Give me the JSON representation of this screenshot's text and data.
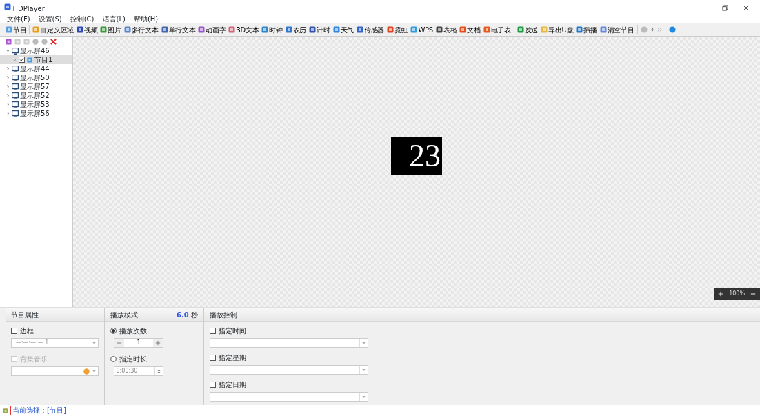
{
  "window": {
    "title": "HDPlayer"
  },
  "menu": [
    "文件(F)",
    "设置(S)",
    "控制(C)",
    "语言(L)",
    "帮助(H)"
  ],
  "toolbar": {
    "groups": [
      [
        {
          "label": "节目"
        }
      ],
      [
        {
          "label": "自定义区域"
        },
        {
          "label": "视频"
        },
        {
          "label": "图片"
        },
        {
          "label": "多行文本"
        },
        {
          "label": "单行文本"
        },
        {
          "label": "动画字"
        },
        {
          "label": "3D文本"
        },
        {
          "label": "时钟"
        },
        {
          "label": "农历"
        },
        {
          "label": "计时"
        },
        {
          "label": "天气"
        },
        {
          "label": "传感器"
        },
        {
          "label": "霓虹"
        },
        {
          "label": "WPS"
        },
        {
          "label": "表格"
        },
        {
          "label": "文档"
        },
        {
          "label": "电子表"
        }
      ],
      [
        {
          "label": "发送"
        },
        {
          "label": "导出U盘"
        },
        {
          "label": "插播"
        },
        {
          "label": "清空节目"
        }
      ]
    ]
  },
  "tree": {
    "items": [
      {
        "label": "显示屏46",
        "expanded": true,
        "children": [
          {
            "label": "节目1",
            "checked": true,
            "selected": true
          }
        ]
      },
      {
        "label": "显示屏44",
        "expanded": false
      },
      {
        "label": "显示屏50",
        "expanded": false
      },
      {
        "label": "显示屏57",
        "expanded": false
      },
      {
        "label": "显示屏52",
        "expanded": false
      },
      {
        "label": "显示屏53",
        "expanded": false
      },
      {
        "label": "显示屏56",
        "expanded": false
      }
    ]
  },
  "canvas": {
    "text": "23",
    "zoom": "100%"
  },
  "program_properties": {
    "title": "节目属性",
    "border": {
      "label": "边框",
      "checked": false,
      "value": "—·—·—·—  1"
    },
    "music": {
      "label": "背景音乐",
      "checked": false,
      "disabled": true
    }
  },
  "play_mode": {
    "title": "播放模式",
    "duration": "6.0",
    "unit": "秒",
    "options": [
      {
        "label": "播放次数",
        "selected": true
      },
      {
        "label": "指定时长",
        "selected": false
      }
    ],
    "count": "1",
    "time": "0:00:30"
  },
  "play_control": {
    "title": "播放控制",
    "options": [
      {
        "label": "指定时间",
        "checked": false
      },
      {
        "label": "指定星期",
        "checked": false
      },
      {
        "label": "指定日期",
        "checked": false
      }
    ]
  },
  "status_bar": {
    "text": "当前选择：[节目]"
  }
}
